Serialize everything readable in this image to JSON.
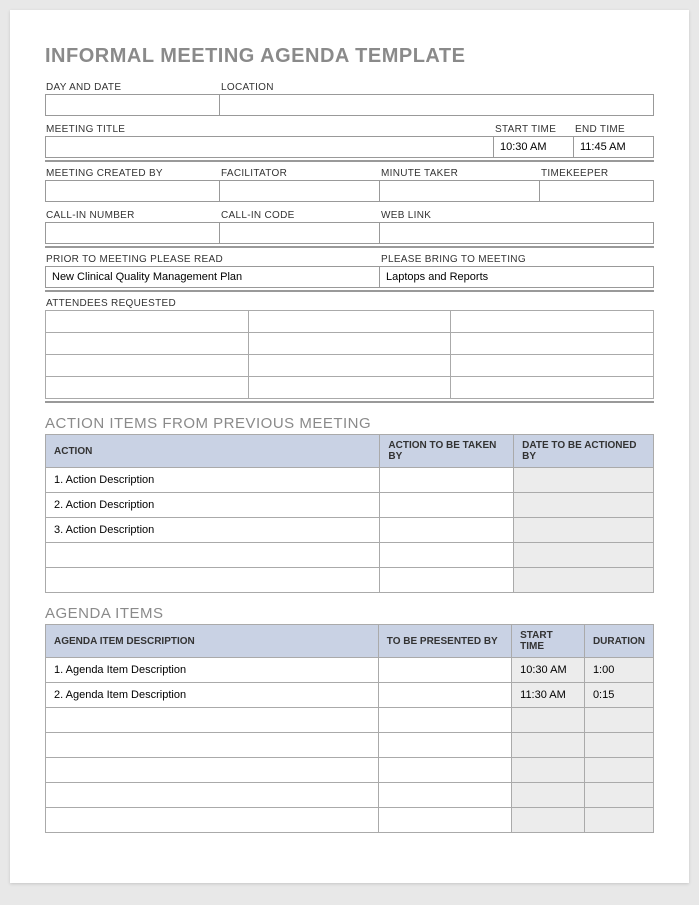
{
  "title": "INFORMAL MEETING AGENDA TEMPLATE",
  "labels": {
    "day_date": "DAY AND DATE",
    "location": "LOCATION",
    "meeting_title": "MEETING TITLE",
    "start_time": "START TIME",
    "end_time": "END TIME",
    "created_by": "MEETING CREATED BY",
    "facilitator": "FACILITATOR",
    "minute_taker": "MINUTE TAKER",
    "timekeeper": "TIMEKEEPER",
    "callin_number": "CALL-IN NUMBER",
    "callin_code": "CALL-IN CODE",
    "web_link": "WEB LINK",
    "prior_read": "PRIOR TO MEETING PLEASE READ",
    "please_bring": "PLEASE BRING TO MEETING",
    "attendees": "ATTENDEES REQUESTED"
  },
  "fields": {
    "day_date": "",
    "location": "",
    "meeting_title": "",
    "start_time": "10:30 AM",
    "end_time": "11:45 AM",
    "created_by": "",
    "facilitator": "",
    "minute_taker": "",
    "timekeeper": "",
    "callin_number": "",
    "callin_code": "",
    "web_link": "",
    "prior_read": "New Clinical Quality Management Plan",
    "please_bring": "Laptops and Reports"
  },
  "sections": {
    "action_items_title": "ACTION ITEMS FROM PREVIOUS MEETING",
    "action_headers": {
      "action": "ACTION",
      "taken_by": "ACTION TO BE TAKEN BY",
      "date": "DATE TO BE ACTIONED BY"
    },
    "action_rows": [
      {
        "action": "1. Action Description",
        "taken_by": "",
        "date": ""
      },
      {
        "action": "2. Action Description",
        "taken_by": "",
        "date": ""
      },
      {
        "action": "3. Action Description",
        "taken_by": "",
        "date": ""
      },
      {
        "action": "",
        "taken_by": "",
        "date": ""
      },
      {
        "action": "",
        "taken_by": "",
        "date": ""
      }
    ],
    "agenda_title": "AGENDA ITEMS",
    "agenda_headers": {
      "desc": "AGENDA ITEM DESCRIPTION",
      "presented": "TO BE PRESENTED BY",
      "start": "START TIME",
      "duration": "DURATION"
    },
    "agenda_rows": [
      {
        "desc": "1. Agenda Item Description",
        "presented": "",
        "start": "10:30 AM",
        "duration": "1:00"
      },
      {
        "desc": "2. Agenda Item Description",
        "presented": "",
        "start": "11:30 AM",
        "duration": "0:15"
      },
      {
        "desc": "",
        "presented": "",
        "start": "",
        "duration": ""
      },
      {
        "desc": "",
        "presented": "",
        "start": "",
        "duration": ""
      },
      {
        "desc": "",
        "presented": "",
        "start": "",
        "duration": ""
      },
      {
        "desc": "",
        "presented": "",
        "start": "",
        "duration": ""
      },
      {
        "desc": "",
        "presented": "",
        "start": "",
        "duration": ""
      }
    ]
  }
}
